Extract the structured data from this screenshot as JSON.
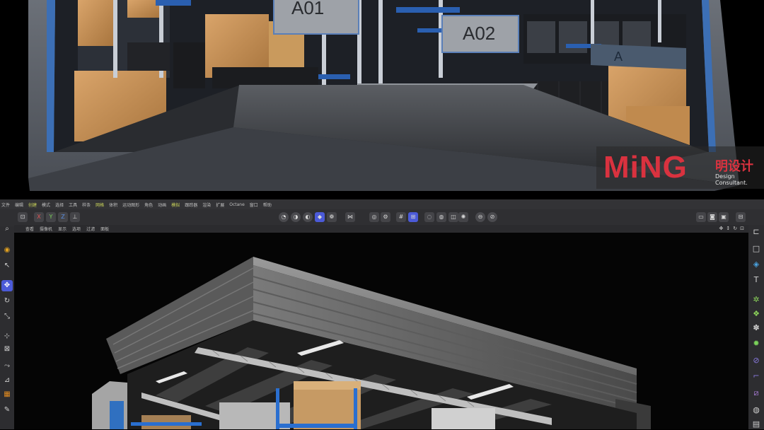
{
  "render": {
    "shelf_labels": [
      "A01",
      "A02",
      "A"
    ],
    "logo": {
      "brand": "MiNG",
      "cn": "明设计",
      "sub1": "Design",
      "sub2": "Consultant."
    }
  },
  "menu": [
    "文件",
    "编辑",
    "创建",
    "模式",
    "选择",
    "工具",
    "样条",
    "网格",
    "体积",
    "运动图形",
    "角色",
    "动画",
    "模拟",
    "跟踪器",
    "渲染",
    "扩展",
    "Octane",
    "窗口",
    "帮助"
  ],
  "viewport_menu": [
    "查看",
    "摄像机",
    "显示",
    "选项",
    "过滤",
    "面板"
  ],
  "axis_labels": [
    "X",
    "Y",
    "Z"
  ],
  "colors": {
    "accent": "#4b5ad8",
    "logo": "#d9323f",
    "menu_highlight": "#c9d35a"
  }
}
